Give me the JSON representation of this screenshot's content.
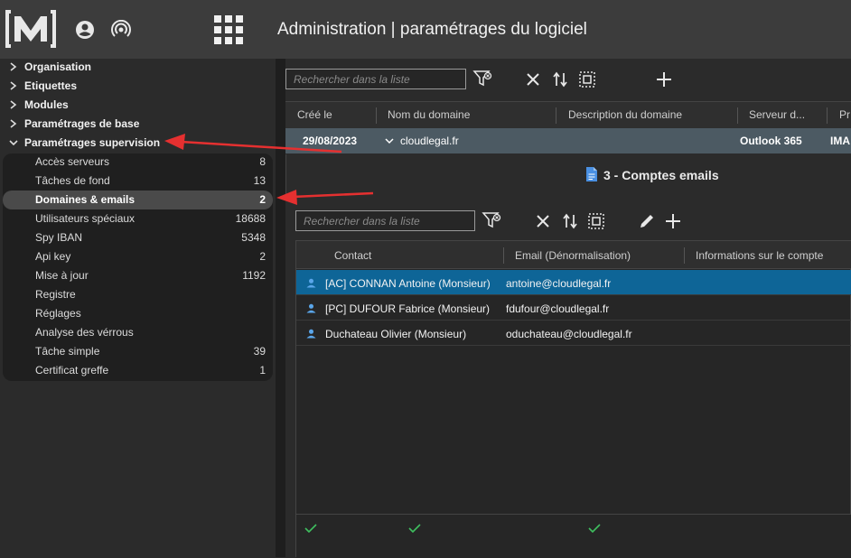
{
  "header": {
    "title": "Administration | paramétrages du logiciel",
    "icons": [
      "logo-icon",
      "user-account-icon",
      "broadcast-icon",
      "apps-grid-icon"
    ]
  },
  "sidebar": {
    "tree": [
      {
        "label": "Organisation",
        "expanded": false
      },
      {
        "label": "Etiquettes",
        "expanded": false
      },
      {
        "label": "Modules",
        "expanded": false
      },
      {
        "label": "Paramétrages de base",
        "expanded": false
      },
      {
        "label": "Paramétrages supervision",
        "expanded": true
      }
    ],
    "items": [
      {
        "label": "Accès serveurs",
        "count": "8"
      },
      {
        "label": "Tâches de fond",
        "count": "13"
      },
      {
        "label": "Domaines & emails",
        "count": "2",
        "active": true
      },
      {
        "label": "Utilisateurs spéciaux",
        "count": "18688"
      },
      {
        "label": "Spy IBAN",
        "count": "5348"
      },
      {
        "label": "Api key",
        "count": "2"
      },
      {
        "label": "Mise à jour",
        "count": "1192"
      },
      {
        "label": "Registre",
        "count": ""
      },
      {
        "label": "Réglages",
        "count": ""
      },
      {
        "label": "Analyse des vérrous",
        "count": ""
      },
      {
        "label": "Tâche simple",
        "count": "39"
      },
      {
        "label": "Certificat greffe",
        "count": "1"
      }
    ]
  },
  "main": {
    "search_placeholder": "Rechercher dans la liste",
    "columns": [
      "Créé le",
      "Nom du domaine",
      "Description du domaine",
      "Serveur d...",
      "Pr"
    ],
    "row": {
      "date": "29/08/2023",
      "domain": "cloudlegal.fr",
      "server": "Outlook 365",
      "protocol": "IMA"
    },
    "detail_title": "3 - Comptes emails",
    "sub_search_placeholder": "Rechercher dans la liste",
    "sub_columns": [
      "Contact",
      "Email (Dénormalisation)",
      "Informations sur le compte"
    ],
    "contacts": [
      {
        "name": "[AC] CONNAN Antoine (Monsieur)",
        "email": "antoine@cloudlegal.fr",
        "selected": true
      },
      {
        "name": "[PC] DUFOUR Fabrice (Monsieur)",
        "email": "fdufour@cloudlegal.fr",
        "selected": false
      },
      {
        "name": "Duchateau Olivier (Monsieur)",
        "email": "oduchateau@cloudlegal.fr",
        "selected": false
      }
    ]
  },
  "colors": {
    "accent_selection": "#0e6597",
    "annotation_arrow": "#e53030",
    "document_icon": "#4a90e2"
  }
}
